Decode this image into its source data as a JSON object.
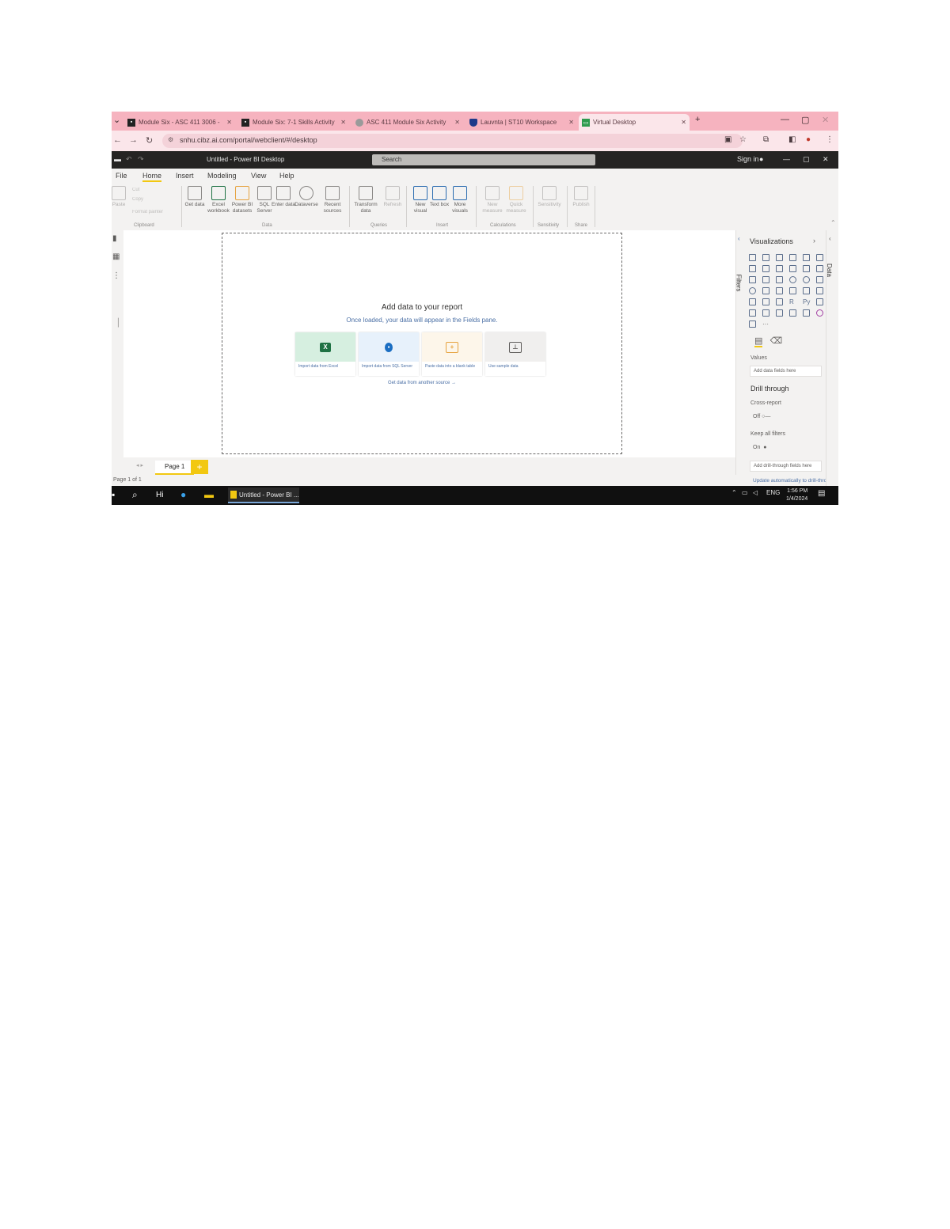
{
  "browser": {
    "tabs": [
      {
        "label": "Module Six - ASC 411 3006 -",
        "favicon": "course-icon",
        "color": "#222222"
      },
      {
        "label": "Module Six: 7-1 Skills Activity",
        "favicon": "course-icon",
        "color": "#222222"
      },
      {
        "label": "ASC 411 Module Six Activity",
        "favicon": "globe-icon",
        "color": "#6b6b6b"
      },
      {
        "label": "Lauvnta | ST10 Workspace",
        "favicon": "shield-icon",
        "color": "#1e3a8a"
      },
      {
        "label": "Virtual Desktop",
        "favicon": "desktop-icon",
        "color": "#2e9b4e",
        "active": true
      }
    ],
    "new_tab": "+",
    "url": "snhu.cibz.ai.com/portal/webclient/#/desktop",
    "window_controls": {
      "minimize": "—",
      "maximize": "▢",
      "close": "✕"
    }
  },
  "app": {
    "title": "Untitled - Power BI Desktop",
    "search_placeholder": "Search",
    "user": "Sign in",
    "window_controls": {
      "minimize": "—",
      "maximize": "▢",
      "close": "✕"
    }
  },
  "menu": {
    "items": [
      {
        "label": "File"
      },
      {
        "label": "Home",
        "active": true
      },
      {
        "label": "Insert"
      },
      {
        "label": "Modeling"
      },
      {
        "label": "View"
      },
      {
        "label": "Help"
      }
    ]
  },
  "ribbon": {
    "clipboard": {
      "paste": "Paste",
      "cut": "Cut",
      "copy": "Copy",
      "format_painter": "Format painter",
      "group": "Clipboard"
    },
    "data": {
      "buttons": [
        "Get data",
        "Excel workbook",
        "Power BI datasets",
        "SQL Server",
        "Enter data",
        "Dataverse",
        "Recent sources"
      ],
      "group": "Data"
    },
    "queries": {
      "buttons": [
        "Transform data",
        "Refresh"
      ],
      "group": "Queries"
    },
    "insert": {
      "buttons": [
        "New visual",
        "Text box",
        "More visuals"
      ],
      "group": "Insert"
    },
    "calculations": {
      "buttons": [
        "New measure",
        "Quick measure"
      ],
      "group": "Calculations"
    },
    "sensitivity": {
      "buttons": [
        "Sensitivity"
      ],
      "group": "Sensitivity"
    },
    "share": {
      "buttons": [
        "Publish"
      ],
      "group": "Share"
    }
  },
  "canvas": {
    "heading": "Add data to your report",
    "subheading": "Once loaded, your data will appear in the Fields pane.",
    "cards": [
      {
        "caption": "Import data from Excel",
        "icon": "excel-icon",
        "color": "#1f7244",
        "bg": "#d6efe0"
      },
      {
        "caption": "Import data from SQL Server",
        "icon": "sql-icon",
        "color": "#1b6ec2",
        "bg": "#e7f1fb"
      },
      {
        "caption": "Paste data into a blank table",
        "icon": "table-icon",
        "color": "#e6a340",
        "bg": "#fdf6ea"
      },
      {
        "caption": "Use sample data",
        "icon": "sample-icon",
        "color": "#605e5c",
        "bg": "#f0efee"
      }
    ],
    "link": "Get data from another source →"
  },
  "pages": {
    "tabs": [
      "Page 1"
    ],
    "add": "+",
    "status": "Page 1 of 1"
  },
  "filters": {
    "label": "Filters"
  },
  "visualizations": {
    "title": "Visualizations",
    "values_label": "Values",
    "values_placeholder": "Add data fields here",
    "drill_through": "Drill through",
    "cross_report": "Cross-report",
    "cross_report_state": "Off",
    "keep_all_filters": "Keep all filters",
    "keep_all_filters_state": "On",
    "drill_placeholder": "Add drill-through fields here",
    "update_note": "Update automatically to drill-through"
  },
  "data_pane": {
    "label": "Data"
  },
  "taskbar": {
    "app": "Untitled - Power BI ...",
    "lang": "ENG",
    "time": "1:56 PM",
    "date": "1/4/2024"
  }
}
